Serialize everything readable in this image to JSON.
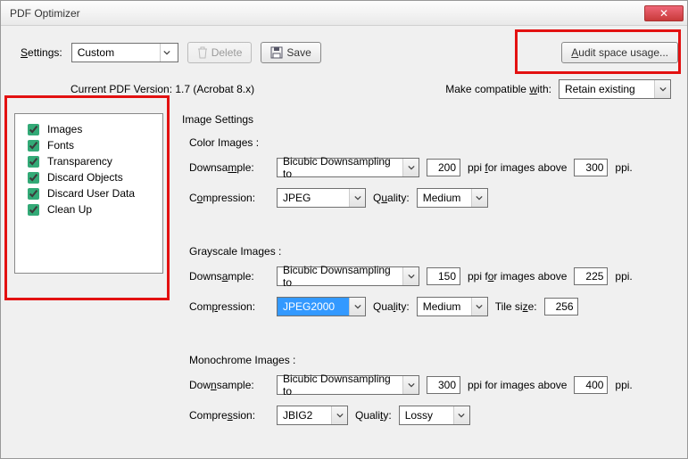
{
  "window": {
    "title": "PDF Optimizer"
  },
  "toolbar": {
    "settings_label": "Settings:",
    "settings_value": "Custom",
    "delete_label": "Delete",
    "save_label": "Save",
    "audit_label": "Audit space usage..."
  },
  "version": {
    "text": "Current PDF Version: 1.7 (Acrobat 8.x)",
    "compat_label": "Make compatible with:",
    "compat_value": "Retain existing"
  },
  "categories": [
    {
      "label": "Images",
      "checked": true
    },
    {
      "label": "Fonts",
      "checked": true
    },
    {
      "label": "Transparency",
      "checked": true
    },
    {
      "label": "Discard Objects",
      "checked": true
    },
    {
      "label": "Discard User Data",
      "checked": true
    },
    {
      "label": "Clean Up",
      "checked": true
    }
  ],
  "pane": {
    "title": "Image Settings",
    "color": {
      "heading": "Color Images :",
      "downsample_label": "Downsample:",
      "downsample_method": "Bicubic Downsampling to",
      "ppi": "200",
      "ppi_mid": "ppi for images above",
      "above": "300",
      "ppi_end": "ppi.",
      "compression_label": "Compression:",
      "compression_method": "JPEG",
      "quality_label": "Quality:",
      "quality_value": "Medium"
    },
    "gray": {
      "heading": "Grayscale Images :",
      "downsample_label": "Downsample:",
      "downsample_method": "Bicubic Downsampling to",
      "ppi": "150",
      "ppi_mid": "ppi for images above",
      "above": "225",
      "ppi_end": "ppi.",
      "compression_label": "Compression:",
      "compression_method": "JPEG2000",
      "quality_label": "Quality:",
      "quality_value": "Medium",
      "tile_label": "Tile size:",
      "tile_value": "256"
    },
    "mono": {
      "heading": "Monochrome Images :",
      "downsample_label": "Downsample:",
      "downsample_method": "Bicubic Downsampling to",
      "ppi": "300",
      "ppi_mid": "ppi for images above",
      "above": "400",
      "ppi_end": "ppi.",
      "compression_label": "Compression:",
      "compression_method": "JBIG2",
      "quality_label": "Quality:",
      "quality_value": "Lossy"
    }
  }
}
